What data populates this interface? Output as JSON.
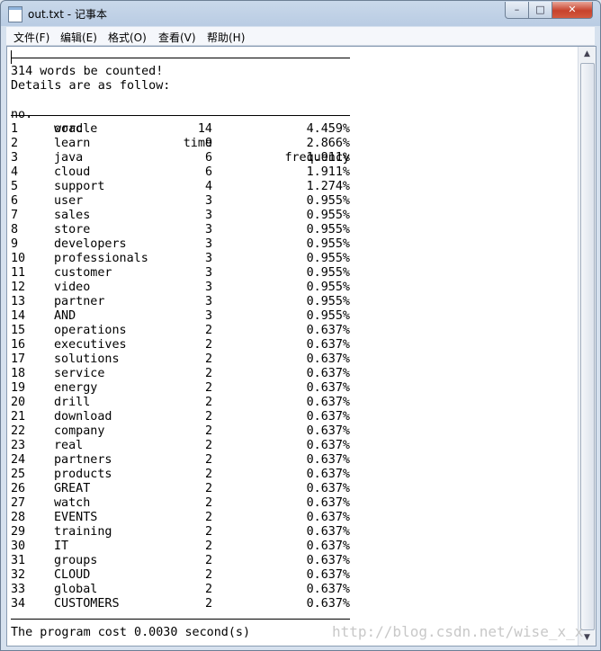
{
  "window": {
    "title": "out.txt - 记事本"
  },
  "controls": {
    "minimize": "–",
    "maximize": "□",
    "close": "✕"
  },
  "menu": [
    "文件(F)",
    "编辑(E)",
    "格式(O)",
    "查看(V)",
    "帮助(H)"
  ],
  "document": {
    "summary": "314 words be counted!",
    "details": "Details are as follow:",
    "headers": {
      "no": "no.",
      "word": "word",
      "time": "time",
      "frequency": "frequency"
    },
    "rows": [
      {
        "no": "1",
        "word": "oracle",
        "time": "14",
        "freq": "4.459%"
      },
      {
        "no": "2",
        "word": "learn",
        "time": "9",
        "freq": "2.866%"
      },
      {
        "no": "3",
        "word": "java",
        "time": "6",
        "freq": "1.911%"
      },
      {
        "no": "4",
        "word": "cloud",
        "time": "6",
        "freq": "1.911%"
      },
      {
        "no": "5",
        "word": "support",
        "time": "4",
        "freq": "1.274%"
      },
      {
        "no": "6",
        "word": "user",
        "time": "3",
        "freq": "0.955%"
      },
      {
        "no": "7",
        "word": "sales",
        "time": "3",
        "freq": "0.955%"
      },
      {
        "no": "8",
        "word": "store",
        "time": "3",
        "freq": "0.955%"
      },
      {
        "no": "9",
        "word": "developers",
        "time": "3",
        "freq": "0.955%"
      },
      {
        "no": "10",
        "word": "professionals",
        "time": "3",
        "freq": "0.955%"
      },
      {
        "no": "11",
        "word": "customer",
        "time": "3",
        "freq": "0.955%"
      },
      {
        "no": "12",
        "word": "video",
        "time": "3",
        "freq": "0.955%"
      },
      {
        "no": "13",
        "word": "partner",
        "time": "3",
        "freq": "0.955%"
      },
      {
        "no": "14",
        "word": "AND",
        "time": "3",
        "freq": "0.955%"
      },
      {
        "no": "15",
        "word": "operations",
        "time": "2",
        "freq": "0.637%"
      },
      {
        "no": "16",
        "word": "executives",
        "time": "2",
        "freq": "0.637%"
      },
      {
        "no": "17",
        "word": "solutions",
        "time": "2",
        "freq": "0.637%"
      },
      {
        "no": "18",
        "word": "service",
        "time": "2",
        "freq": "0.637%"
      },
      {
        "no": "19",
        "word": "energy",
        "time": "2",
        "freq": "0.637%"
      },
      {
        "no": "20",
        "word": "drill",
        "time": "2",
        "freq": "0.637%"
      },
      {
        "no": "21",
        "word": "download",
        "time": "2",
        "freq": "0.637%"
      },
      {
        "no": "22",
        "word": "company",
        "time": "2",
        "freq": "0.637%"
      },
      {
        "no": "23",
        "word": "real",
        "time": "2",
        "freq": "0.637%"
      },
      {
        "no": "24",
        "word": "partners",
        "time": "2",
        "freq": "0.637%"
      },
      {
        "no": "25",
        "word": "products",
        "time": "2",
        "freq": "0.637%"
      },
      {
        "no": "26",
        "word": "GREAT",
        "time": "2",
        "freq": "0.637%"
      },
      {
        "no": "27",
        "word": "watch",
        "time": "2",
        "freq": "0.637%"
      },
      {
        "no": "28",
        "word": "EVENTS",
        "time": "2",
        "freq": "0.637%"
      },
      {
        "no": "29",
        "word": "training",
        "time": "2",
        "freq": "0.637%"
      },
      {
        "no": "30",
        "word": "IT",
        "time": "2",
        "freq": "0.637%"
      },
      {
        "no": "31",
        "word": "groups",
        "time": "2",
        "freq": "0.637%"
      },
      {
        "no": "32",
        "word": "CLOUD",
        "time": "2",
        "freq": "0.637%"
      },
      {
        "no": "33",
        "word": "global",
        "time": "2",
        "freq": "0.637%"
      },
      {
        "no": "34",
        "word": "CUSTOMERS",
        "time": "2",
        "freq": "0.637%"
      }
    ],
    "footer": "The program cost 0.0030 second(s)"
  },
  "watermark": "http://blog.csdn.net/wise_x_x"
}
